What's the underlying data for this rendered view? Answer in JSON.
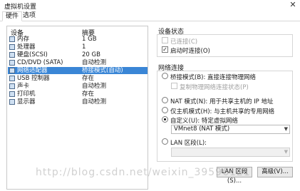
{
  "window": {
    "title": "虚拟机设置",
    "close_glyph": "✕"
  },
  "tabs": [
    {
      "label": "硬件"
    },
    {
      "label": "选项"
    }
  ],
  "devices": {
    "header": {
      "device": "设备",
      "summary": "摘要"
    },
    "rows": [
      {
        "name": "内存",
        "summary": "1 GB",
        "icon": "memory-icon"
      },
      {
        "name": "处理器",
        "summary": "1",
        "icon": "processor-icon"
      },
      {
        "name": "硬盘(SCSI)",
        "summary": "20 GB",
        "icon": "hard-disk-icon"
      },
      {
        "name": "CD/DVD (SATA)",
        "summary": "自动检测",
        "icon": "cd-dvd-icon"
      },
      {
        "name": "网络适配器",
        "summary": "桥接模式(自动)",
        "icon": "network-adapter-icon"
      },
      {
        "name": "USB 控制器",
        "summary": "存在",
        "icon": "usb-controller-icon"
      },
      {
        "name": "声卡",
        "summary": "自动检测",
        "icon": "sound-card-icon"
      },
      {
        "name": "打印机",
        "summary": "存在",
        "icon": "printer-icon"
      },
      {
        "name": "显示器",
        "summary": "自动检测",
        "icon": "display-icon"
      }
    ],
    "selected_index": 4
  },
  "device_status": {
    "title": "设备状态",
    "connected": {
      "label": "已连接(C)",
      "checked": false,
      "enabled": false
    },
    "connect_on_power": {
      "label": "启动时连接(O)",
      "checked": true,
      "enabled": true
    }
  },
  "network": {
    "title": "网络连接",
    "bridged": {
      "label": "桥接模式(B): 直接连接物理网络",
      "selected": false
    },
    "replicate": {
      "label": "复制物理网络连接状态(P)",
      "checked": false,
      "enabled": false
    },
    "nat": {
      "label": "NAT 模式(N): 用于共享主机的 IP 地址",
      "selected": false
    },
    "host_only": {
      "label": "仅主机模式(H): 与主机共享的专用网络",
      "selected": false
    },
    "custom": {
      "label": "自定义(U): 特定虚拟网络",
      "selected": true
    },
    "custom_value": "VMnet8 (NAT 模式)",
    "lan_segment": {
      "label": "LAN 区段(L):",
      "selected": false
    },
    "lan_value": ""
  },
  "buttons": {
    "lan_segments": "LAN 区段(S)...",
    "advanced": "高级(V)..."
  },
  "watermark": "http://blog.csdn.net/weixin_39596121"
}
